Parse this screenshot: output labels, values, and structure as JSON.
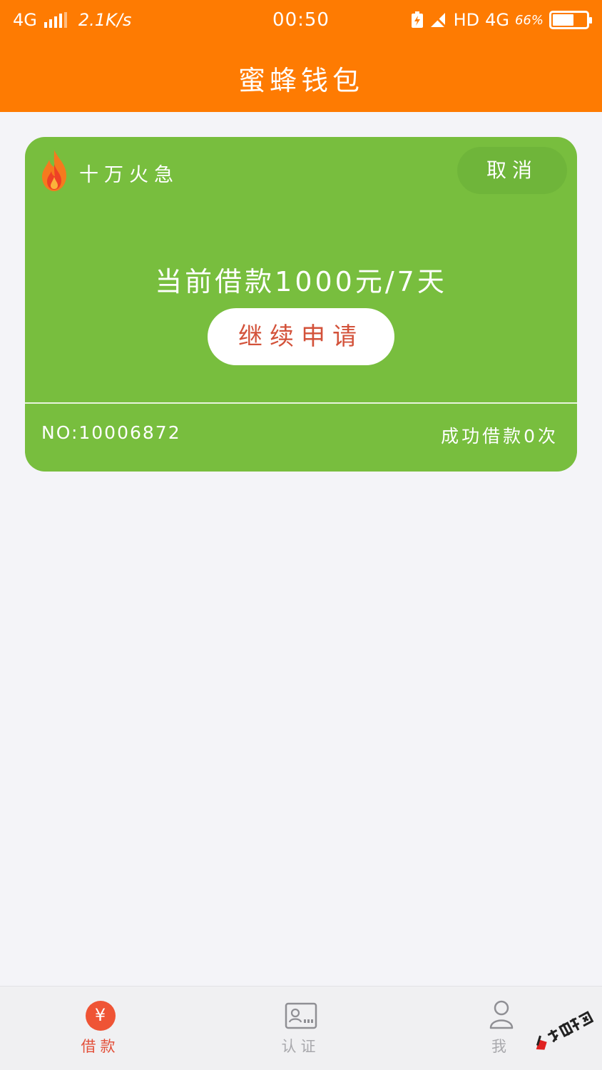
{
  "status_bar": {
    "network": "4G",
    "speed": "2.1K/s",
    "time": "00:50",
    "hd": "HD",
    "network_right": "4G",
    "battery_percent": "66%",
    "battery_level": 0.66
  },
  "header": {
    "title": "蜜蜂钱包"
  },
  "loan_card": {
    "tag": "十万火急",
    "cancel_label": "取消",
    "current_loan": "当前借款1000元/7天",
    "continue_label": "继续申请",
    "number": "NO:10006872",
    "success_count": "成功借款0次"
  },
  "tabbar": {
    "tabs": [
      {
        "label": "借款",
        "icon": "yen-icon",
        "active": true
      },
      {
        "label": "认证",
        "icon": "id-card-icon",
        "active": false
      },
      {
        "label": "我",
        "icon": "person-icon",
        "active": false
      }
    ],
    "yen_symbol": "¥"
  },
  "colors": {
    "header": "#fe7b02",
    "card": "#78be3e",
    "accent": "#e3503a"
  }
}
